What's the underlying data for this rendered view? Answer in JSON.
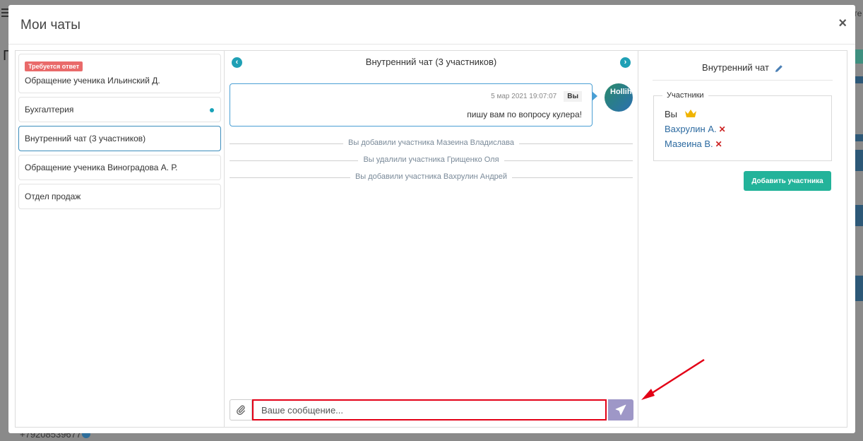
{
  "modal": {
    "title": "Мои чаты",
    "close": "×"
  },
  "chats": [
    {
      "label": "Обращение ученика Ильинский Д.",
      "badge": "Требуется ответ"
    },
    {
      "label": "Бухгалтерия",
      "unread": true
    },
    {
      "label": "Внутренний чат (3 участников)",
      "active": true
    },
    {
      "label": "Обращение ученика Виноградова А. Р."
    },
    {
      "label": "Отдел продаж"
    }
  ],
  "conversation": {
    "title": "Внутренний чат (3 участников)",
    "message": {
      "timestamp": "5 мар 2021 19:07:07",
      "author": "Вы",
      "text": "пишу вам по вопросу кулера!",
      "avatar_text": "Hollih"
    },
    "system_events": [
      "Вы добавили участника Мазеина Владислава",
      "Вы удалили участника Грищенко Оля",
      "Вы добавили участника Вахрулин Андрей"
    ],
    "input": {
      "placeholder": "Ваше сообщение..."
    }
  },
  "details": {
    "title": "Внутренний чат",
    "participants_legend": "Участники",
    "you": "Вы",
    "participants": [
      "Вахрулин А.",
      "Мазеина В."
    ],
    "remove_symbol": "✕",
    "add_button": "Добавить участника"
  },
  "background": {
    "phone": "+79208539677",
    "right_text": "ате"
  },
  "colors": {
    "accent": "#1fa0b5",
    "badge": "#e96a6a",
    "add_button": "#23b39a",
    "send_button": "#9e97c7",
    "highlight": "#e30016"
  }
}
